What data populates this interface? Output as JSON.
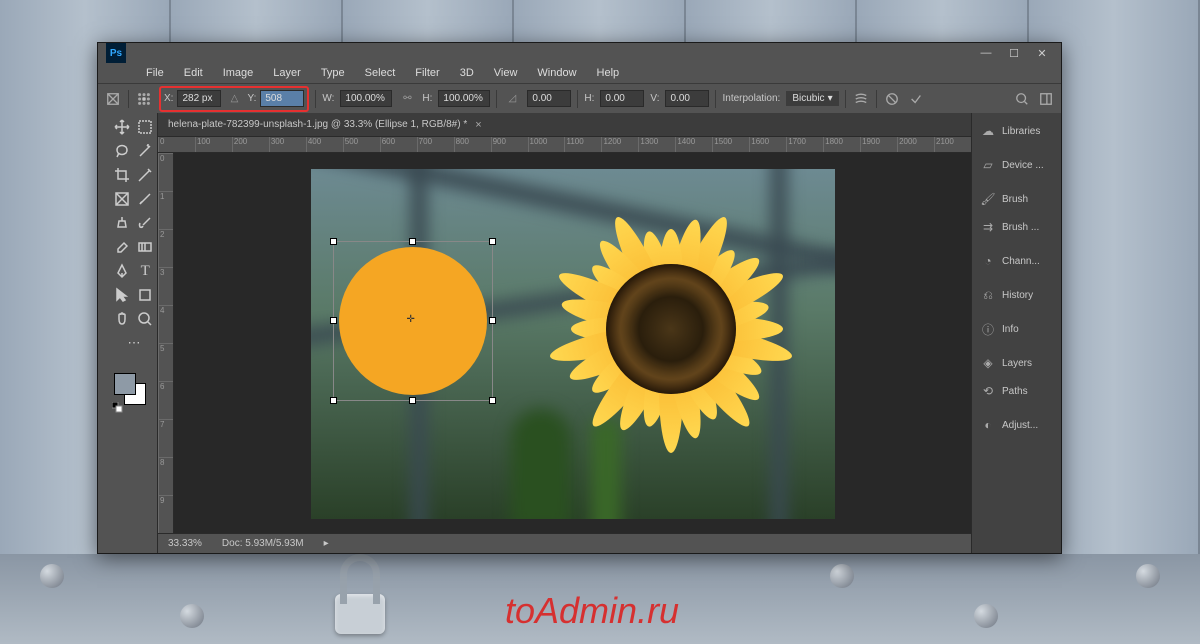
{
  "watermark": "toAdmin.ru",
  "menubar": [
    "File",
    "Edit",
    "Image",
    "Layer",
    "Type",
    "Select",
    "Filter",
    "3D",
    "View",
    "Window",
    "Help"
  ],
  "options": {
    "x_label": "X:",
    "x_value": "282 px",
    "y_label": "Y:",
    "y_value": "508",
    "w_label": "W:",
    "w_value": "100.00%",
    "h_label": "H:",
    "h_value": "100.00%",
    "angle_value": "0.00",
    "skew_h_label": "H:",
    "skew_h_value": "0.00",
    "skew_v_label": "V:",
    "skew_v_value": "0.00",
    "interp_label": "Interpolation:",
    "interp_value": "Bicubic"
  },
  "document": {
    "tab_title": "helena-plate-782399-unsplash-1.jpg @ 33.3% (Ellipse 1, RGB/8#) *",
    "zoom": "33.33%",
    "docsize": "Doc: 5.93M/5.93M"
  },
  "ruler_h": [
    "0",
    "100",
    "200",
    "300",
    "400",
    "500",
    "600",
    "700",
    "800",
    "900",
    "1000",
    "1100",
    "1200",
    "1300",
    "1400",
    "1500",
    "1600",
    "1700",
    "1800",
    "1900",
    "2000",
    "2100"
  ],
  "ruler_v": [
    "0",
    "100",
    "200",
    "300",
    "400",
    "500",
    "600",
    "700",
    "800",
    "900"
  ],
  "panels": [
    {
      "icon": "☁",
      "label": "Libraries"
    },
    {
      "sep": true
    },
    {
      "icon": "▱",
      "label": "Device ..."
    },
    {
      "sep": true
    },
    {
      "icon": "🖌",
      "label": "Brush"
    },
    {
      "icon": "⇉",
      "label": "Brush ..."
    },
    {
      "sep": true
    },
    {
      "icon": "◔",
      "label": "Chann..."
    },
    {
      "sep": true
    },
    {
      "icon": "⎌",
      "label": "History"
    },
    {
      "sep": true
    },
    {
      "icon": "ⓘ",
      "label": "Info"
    },
    {
      "sep": true
    },
    {
      "icon": "◈",
      "label": "Layers"
    },
    {
      "icon": "⟲",
      "label": "Paths"
    },
    {
      "sep": true
    },
    {
      "icon": "◐",
      "label": "Adjust..."
    }
  ],
  "swatches": {
    "fg": "#8e9aa6",
    "bg": "#ffffff"
  }
}
